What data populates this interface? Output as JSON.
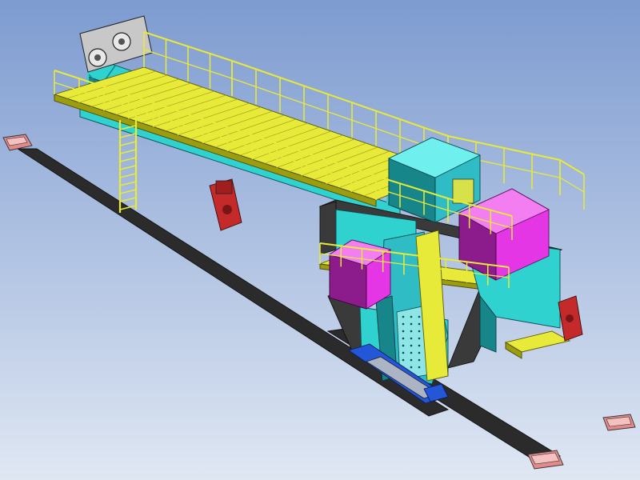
{
  "scene": {
    "background_top": "#7d9bd0",
    "background_bottom": "#dfe7f3"
  },
  "palette": {
    "steel": "#2fd2cf",
    "steel_dark": "#16868a",
    "walkway": "#e8ea3a",
    "walkway_dark": "#9c9c10",
    "housing": "#e536e5",
    "housing_dark": "#8c1b8c",
    "frame": "#3a3a3a",
    "rail": "#2b2b2b",
    "motor": "#c52a2a",
    "base_plate": "#e28a8a",
    "buffer_blue": "#2456d8",
    "chute": "#2fbcc4"
  }
}
